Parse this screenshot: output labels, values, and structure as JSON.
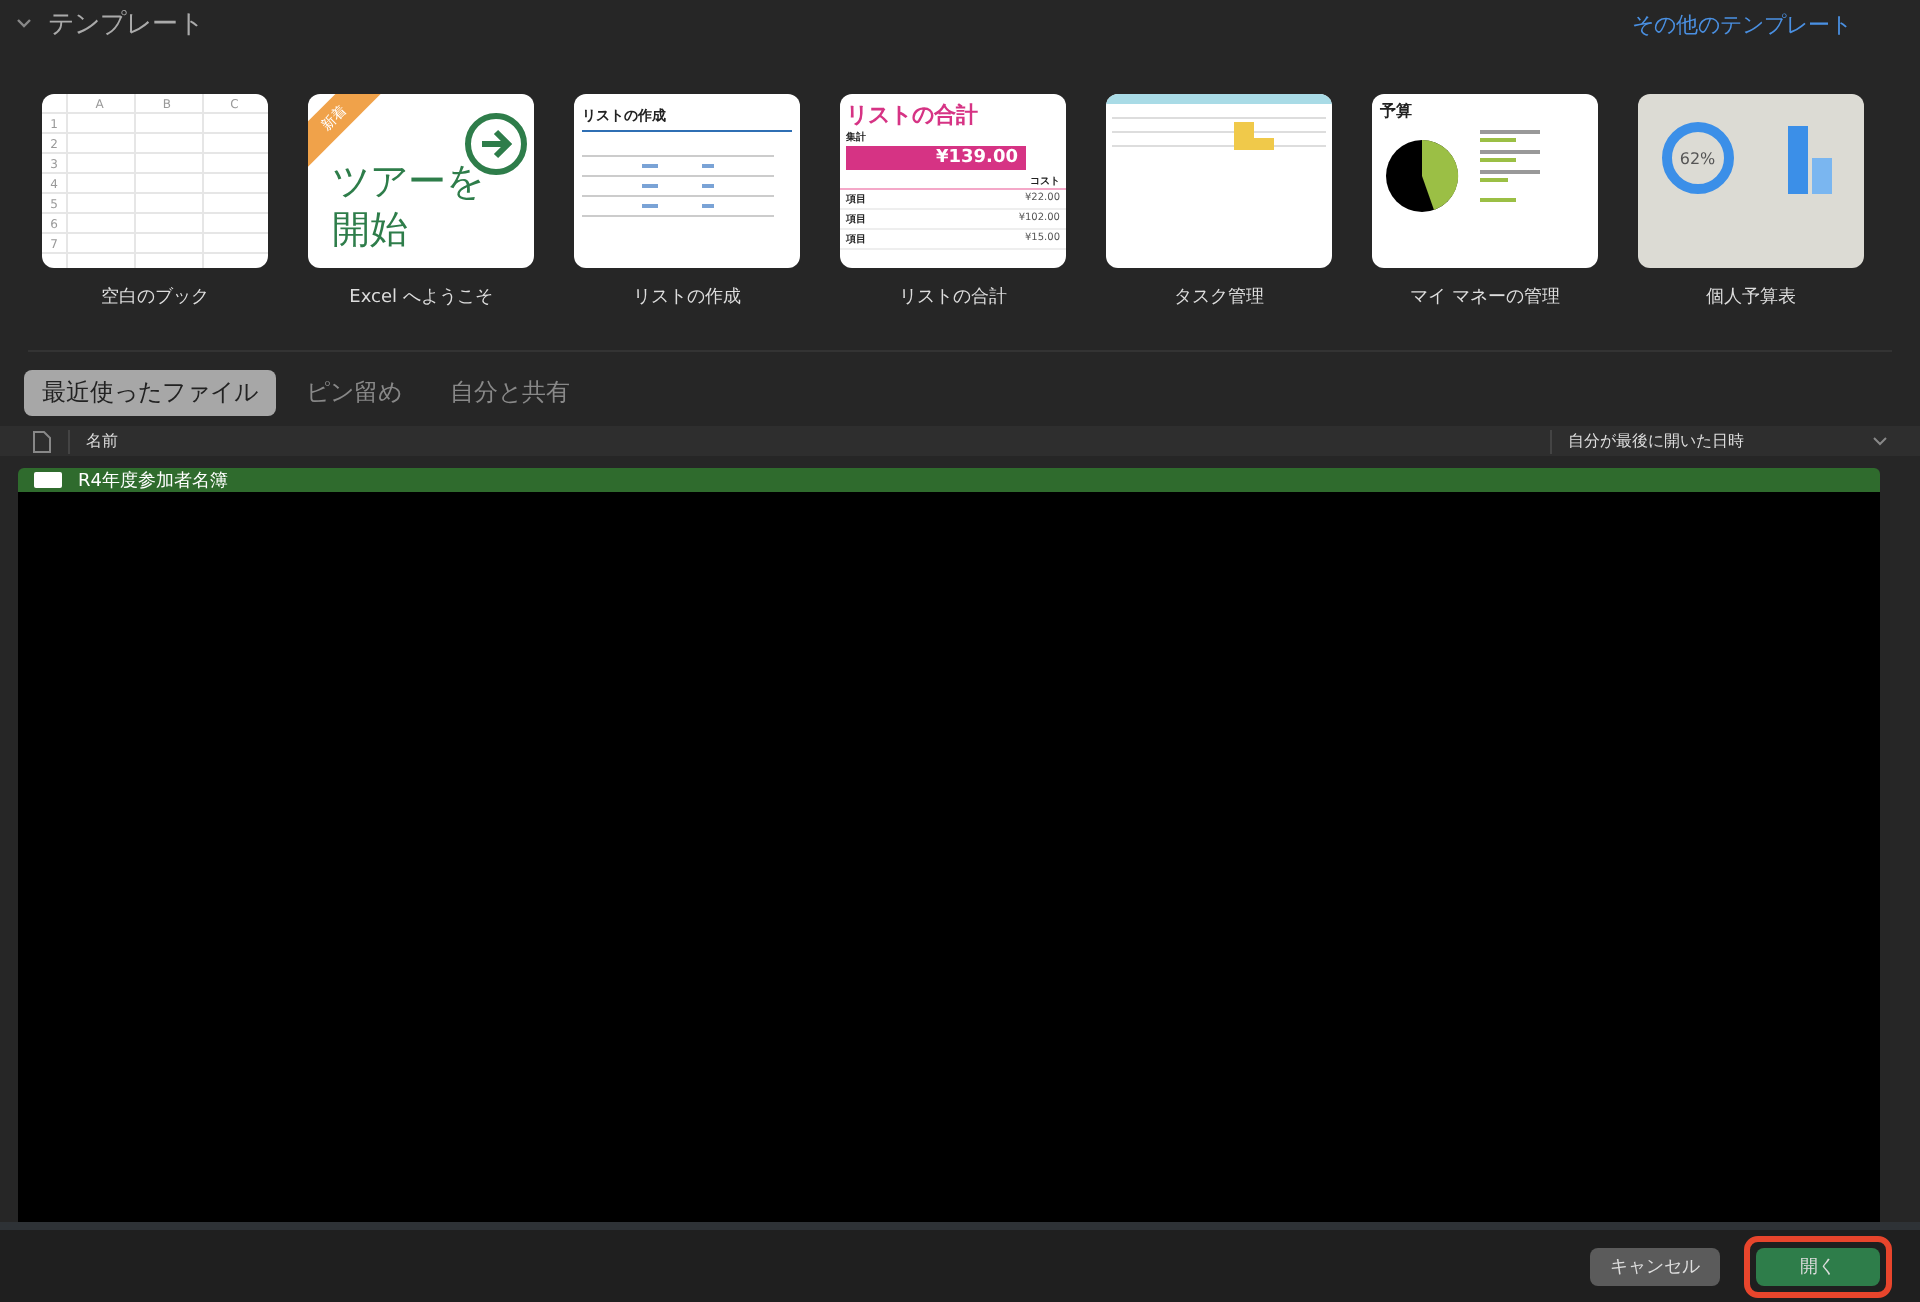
{
  "templates_section": {
    "title": "テンプレート",
    "expanded": true,
    "more_link": "その他のテンプレート"
  },
  "templates": [
    {
      "kind": "blank",
      "label": "空白のブック",
      "columns": [
        "A",
        "B",
        "C"
      ],
      "rows": [
        "1",
        "2",
        "3",
        "4",
        "5",
        "6",
        "7"
      ]
    },
    {
      "kind": "tour",
      "label": "Excel へようこそ",
      "badge": "新着",
      "heading": "ツアーを開始"
    },
    {
      "kind": "list",
      "label": "リストの作成",
      "heading": "リストの作成"
    },
    {
      "kind": "total",
      "label": "リストの合計",
      "heading": "リストの合計",
      "sum_label": "集計",
      "sum": "¥139.00",
      "cost_label": "コスト",
      "items": [
        {
          "name": "項目",
          "amount": "¥22.00"
        },
        {
          "name": "項目",
          "amount": "¥102.00"
        },
        {
          "name": "項目",
          "amount": "¥15.00"
        }
      ]
    },
    {
      "kind": "tasks",
      "label": "タスク管理"
    },
    {
      "kind": "money",
      "label": "マイ マネーの管理",
      "heading": "予算"
    },
    {
      "kind": "budget",
      "label": "個人予算表",
      "percent": "62%"
    }
  ],
  "tabs": [
    {
      "label": "最近使ったファイル",
      "selected": true
    },
    {
      "label": "ピン留め",
      "selected": false
    },
    {
      "label": "自分と共有",
      "selected": false
    }
  ],
  "table": {
    "columns": [
      "名前",
      "自分が最後に開いた日時"
    ],
    "rows": [
      {
        "name": "R4年度参加者名簿",
        "selected": true
      }
    ]
  },
  "buttons": [
    {
      "label": "キャンセル",
      "kind": "secondary",
      "highlighted": false
    },
    {
      "label": "開く",
      "kind": "primary",
      "highlighted": true
    }
  ]
}
